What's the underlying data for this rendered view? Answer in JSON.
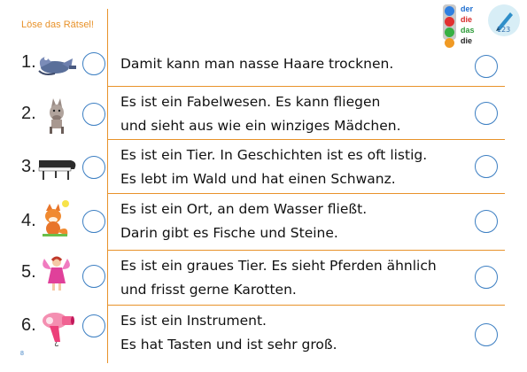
{
  "header": {
    "title": "Löse das Rätsel!",
    "legend": [
      {
        "word": "der",
        "color": "#1f6fd0",
        "dot": "#2f7fe0"
      },
      {
        "word": "die",
        "color": "#d62a2a",
        "dot": "#e23030"
      },
      {
        "word": "das",
        "color": "#2e9c3a",
        "dot": "#37b043"
      },
      {
        "word": "die",
        "color": "#222222",
        "dot": "#f09a24"
      }
    ],
    "logo_text": "123"
  },
  "rows": [
    {
      "number": "1.",
      "icon": "hair-dryer-dragon-picture",
      "line1": "Damit kann man nasse Haare trocknen.",
      "line2": ""
    },
    {
      "number": "2.",
      "icon": "donkey-picture",
      "line1": "Es ist ein Fabelwesen. Es kann fliegen",
      "line2": "und sieht aus wie ein winziges Mädchen."
    },
    {
      "number": "3.",
      "icon": "piano-picture",
      "line1": "Es ist ein Tier. In Geschichten ist es oft listig.",
      "line2": "Es lebt im Wald und hat einen Schwanz."
    },
    {
      "number": "4.",
      "icon": "fox-picture",
      "line1": "Es ist ein Ort, an dem Wasser fließt.",
      "line2": "Darin gibt es Fische und Steine."
    },
    {
      "number": "5.",
      "icon": "fairy-picture",
      "line1": "Es ist ein graues Tier. Es sieht Pferden ähnlich",
      "line2": "und frisst gerne Karotten."
    },
    {
      "number": "6.",
      "icon": "hair-dryer-picture",
      "line1": "Es ist ein Instrument.",
      "line2": "Es hat Tasten und ist sehr groß."
    }
  ],
  "footer": {
    "page_number": "8"
  }
}
